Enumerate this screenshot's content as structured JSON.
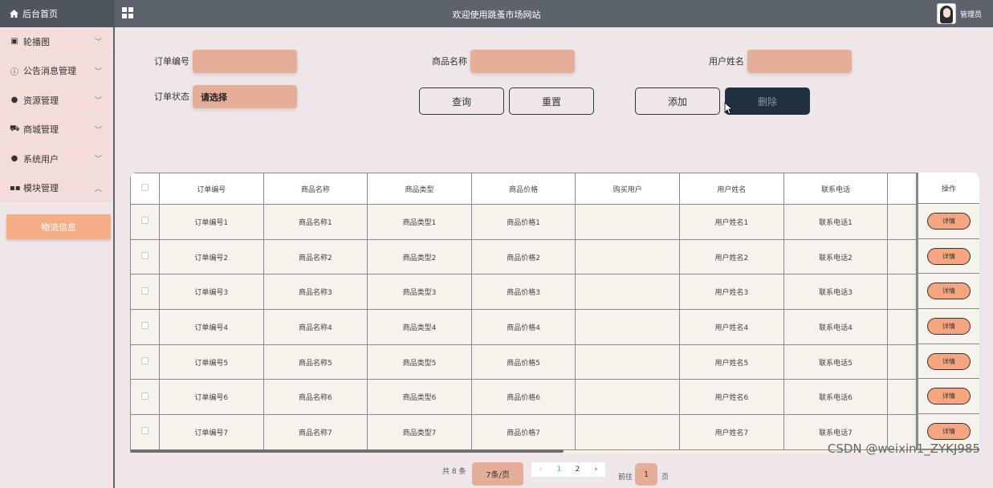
{
  "header": {
    "home_label": "后台首页",
    "site_title": "欢迎使用跳蚤市场网站",
    "user_label": "管理员"
  },
  "sidebar": {
    "items": [
      {
        "label": "轮播图",
        "icon": "image-icon"
      },
      {
        "label": "公告消息管理",
        "icon": "info-icon"
      },
      {
        "label": "资源管理",
        "icon": "pin-icon"
      },
      {
        "label": "商城管理",
        "icon": "cart-icon"
      },
      {
        "label": "系统用户",
        "icon": "user-icon"
      },
      {
        "label": "模块管理",
        "icon": "grid-icon"
      }
    ],
    "sub_item": "物流信息"
  },
  "search": {
    "order_no_label": "订单编号",
    "product_name_label": "商品名称",
    "user_name_label": "用户姓名",
    "order_status_label": "订单状态",
    "order_status_value": "请选择",
    "query_button": "查询",
    "reset_button": "重置",
    "add_button": "添加",
    "delete_button": "删除"
  },
  "table": {
    "columns": [
      "订单编号",
      "商品名称",
      "商品类型",
      "商品价格",
      "购买用户",
      "用户姓名",
      "联系电话",
      ""
    ],
    "op_header": "操作",
    "detail_label": "详情",
    "rows": [
      [
        "订单编号1",
        "商品名称1",
        "商品类型1",
        "商品价格1",
        "",
        "用户姓名1",
        "联系电话1",
        ""
      ],
      [
        "订单编号2",
        "商品名称2",
        "商品类型2",
        "商品价格2",
        "",
        "用户姓名2",
        "联系电话2",
        ""
      ],
      [
        "订单编号3",
        "商品名称3",
        "商品类型3",
        "商品价格3",
        "",
        "用户姓名3",
        "联系电话3",
        ""
      ],
      [
        "订单编号4",
        "商品名称4",
        "商品类型4",
        "商品价格4",
        "",
        "用户姓名4",
        "联系电话4",
        ""
      ],
      [
        "订单编号5",
        "商品名称5",
        "商品类型5",
        "商品价格5",
        "",
        "用户姓名5",
        "联系电话5",
        ""
      ],
      [
        "订单编号6",
        "商品名称6",
        "商品类型6",
        "商品价格6",
        "",
        "用户姓名6",
        "联系电话6",
        ""
      ],
      [
        "订单编号7",
        "商品名称7",
        "商品类型7",
        "商品价格7",
        "",
        "用户姓名7",
        "联系电话7",
        ""
      ]
    ]
  },
  "pagination": {
    "total": "共 8 条",
    "page_size": "7条/页",
    "pages": [
      "1",
      "2"
    ],
    "prev": "‹",
    "next": "›",
    "goto_label": "前往",
    "goto_value": "1",
    "goto_unit": "页"
  },
  "watermark": "CSDN @weixin1_ZYKJ985"
}
